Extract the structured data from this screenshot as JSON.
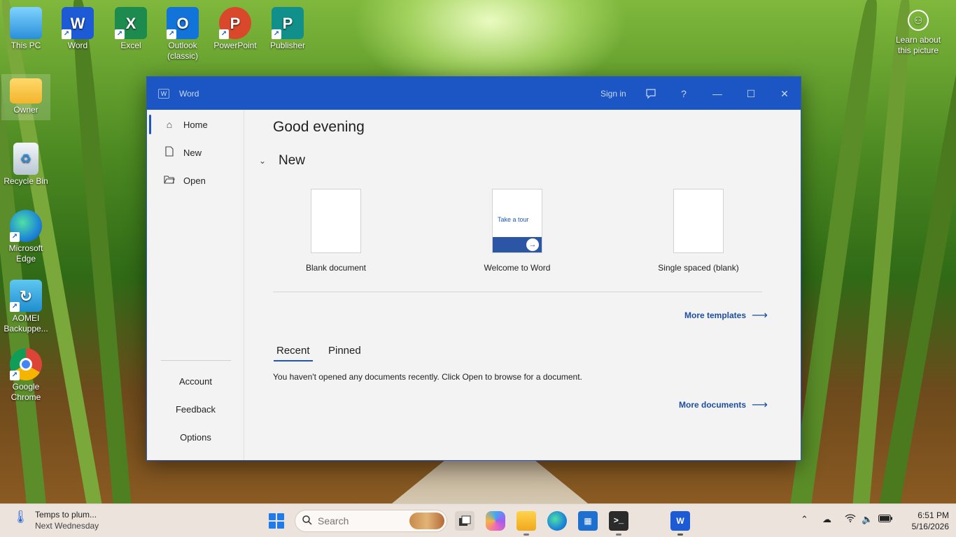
{
  "desktop": {
    "icons": [
      {
        "label": "This PC",
        "icon": "computer-icon"
      },
      {
        "label": "Word",
        "icon": "word-icon"
      },
      {
        "label": "Excel",
        "icon": "excel-icon"
      },
      {
        "label": "Outlook (classic)",
        "icon": "outlook-icon"
      },
      {
        "label": "PowerPoint",
        "icon": "powerpoint-icon"
      },
      {
        "label": "Publisher",
        "icon": "publisher-icon"
      },
      {
        "label": "Owner",
        "icon": "folder-icon"
      },
      {
        "label": "Recycle Bin",
        "icon": "recycle-bin-icon"
      },
      {
        "label": "Microsoft Edge",
        "icon": "edge-icon"
      },
      {
        "label": "AOMEI Backuppe...",
        "icon": "aomei-icon"
      },
      {
        "label": "Google Chrome",
        "icon": "chrome-icon"
      }
    ],
    "learn_label": "Learn about this picture"
  },
  "window": {
    "title": "Word",
    "sign_in": "Sign in",
    "buttons": {
      "feedback": "feedback-icon",
      "help": "?",
      "minimize": "—",
      "maximize": "☐",
      "close": "✕"
    }
  },
  "sidebar": {
    "items": [
      {
        "label": "Home",
        "icon": "home-icon"
      },
      {
        "label": "New",
        "icon": "new-document-icon"
      },
      {
        "label": "Open",
        "icon": "folder-open-icon"
      }
    ],
    "bottom": [
      "Account",
      "Feedback",
      "Options"
    ]
  },
  "main": {
    "greeting": "Good evening",
    "new_section": "New",
    "templates": [
      {
        "label": "Blank document"
      },
      {
        "label": "Welcome to Word",
        "thumb_text": "Take a tour"
      },
      {
        "label": "Single spaced (blank)"
      }
    ],
    "more_templates": "More templates",
    "tabs": [
      "Recent",
      "Pinned"
    ],
    "recent_message": "You haven't opened any documents recently. Click Open to browse for a document.",
    "more_documents": "More documents"
  },
  "taskbar": {
    "weather_title": "Temps to plum...",
    "weather_sub": "Next Wednesday",
    "search_placeholder": "Search",
    "time": "6:51 PM",
    "date": "5/16/2026"
  },
  "colors": {
    "accent": "#1b56c4",
    "link": "#1b4e9e"
  }
}
